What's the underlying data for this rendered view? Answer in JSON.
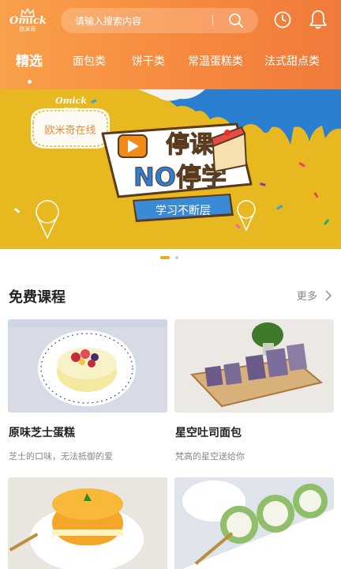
{
  "header": {
    "logo_text": "Omick",
    "logo_sub": "欧米奇",
    "search_placeholder": "请输入搜索内容",
    "icons": [
      "search-icon",
      "clock-icon",
      "bell-icon"
    ]
  },
  "tabs": [
    {
      "label": "精选",
      "active": true
    },
    {
      "label": "面包类",
      "active": false
    },
    {
      "label": "饼干类",
      "active": false
    },
    {
      "label": "常温蛋糕类",
      "active": false
    },
    {
      "label": "法式甜点类",
      "active": false
    }
  ],
  "banner": {
    "brand": "Omick",
    "brand_sub": "欧米奇",
    "badge_text": "欧米奇在线",
    "headline_line1": "停课",
    "headline_line2": "NO停学",
    "ribbon_text": "学习不断层"
  },
  "carousel": {
    "pages": 2,
    "current": 1
  },
  "section": {
    "title": "免费课程",
    "more_label": "更多"
  },
  "courses": [
    {
      "name": "原味芝士蛋糕",
      "desc": "芝士的口味，无法抵御的爱"
    },
    {
      "name": "星空吐司面包",
      "desc": "梵高的星空送给你"
    },
    {
      "name": "",
      "desc": ""
    },
    {
      "name": "",
      "desc": ""
    }
  ],
  "colors": {
    "header_start": "#f9a04a",
    "header_end": "#f07a3a",
    "banner_bg": "#e8b820",
    "accent": "#f5a623"
  }
}
